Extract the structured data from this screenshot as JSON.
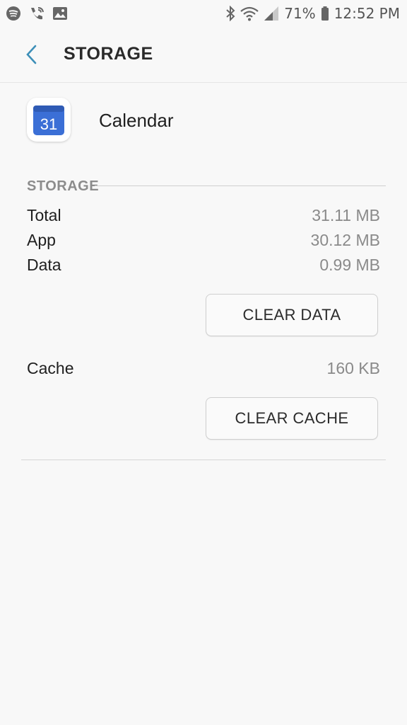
{
  "statusbar": {
    "battery_percent": "71%",
    "time": "12:52 PM",
    "left_icons": [
      "spotify-icon",
      "wifi-calling-icon",
      "image-icon"
    ],
    "right_icons": [
      "bluetooth-icon",
      "wifi-icon",
      "signal-icon",
      "battery-icon"
    ]
  },
  "header": {
    "title": "STORAGE",
    "back_icon": "back-arrow-icon"
  },
  "app": {
    "name": "Calendar",
    "icon_day": "31",
    "icon_color": "#3b6fd6"
  },
  "storage": {
    "section_label": "STORAGE",
    "rows": [
      {
        "label": "Total",
        "value": "31.11 MB"
      },
      {
        "label": "App",
        "value": "30.12 MB"
      },
      {
        "label": "Data",
        "value": "0.99 MB"
      }
    ],
    "clear_data_label": "CLEAR DATA"
  },
  "cache": {
    "label": "Cache",
    "value": "160 KB",
    "clear_cache_label": "CLEAR CACHE"
  },
  "colors": {
    "background": "#f8f8f8",
    "accent": "#3d8fb8",
    "secondary_text": "#8a8a8a"
  }
}
